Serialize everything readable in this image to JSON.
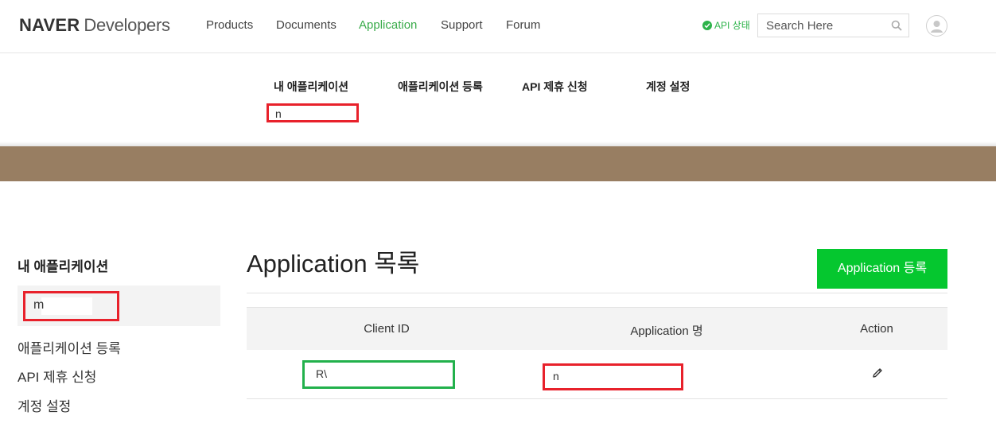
{
  "header": {
    "logo_brand": "NAVER",
    "logo_suffix": "Developers",
    "nav": [
      {
        "label": "Products",
        "active": false
      },
      {
        "label": "Documents",
        "active": false
      },
      {
        "label": "Application",
        "active": true
      },
      {
        "label": "Support",
        "active": false
      },
      {
        "label": "Forum",
        "active": false
      }
    ],
    "api_status": "API 상태",
    "search_placeholder": "Search Here",
    "icons": {
      "status": "check-circle-icon",
      "search": "search-icon",
      "avatar": "user-avatar-icon"
    }
  },
  "subnav": {
    "items": [
      "내 애플리케이션",
      "애플리케이션 등록",
      "API 제휴 신청",
      "계정 설정"
    ],
    "dropdown_value": "n"
  },
  "sidebar": {
    "title": "내 애플리케이션",
    "active_app": "m",
    "items": [
      "애플리케이션 등록",
      "API 제휴 신청",
      "계정 설정"
    ]
  },
  "main": {
    "title": "Application 목록",
    "register_button": "Application 등록",
    "columns": [
      "Client ID",
      "Application 명",
      "Action"
    ],
    "rows": [
      {
        "client_id": "R\\",
        "app_name": "n",
        "action_icon": "pencil-edit-icon"
      }
    ]
  },
  "colors": {
    "accent_green": "#05c72f",
    "active_nav": "#3aab4a",
    "banner": "#987e62",
    "highlight_red": "#e8212b",
    "highlight_green": "#22b14c"
  }
}
